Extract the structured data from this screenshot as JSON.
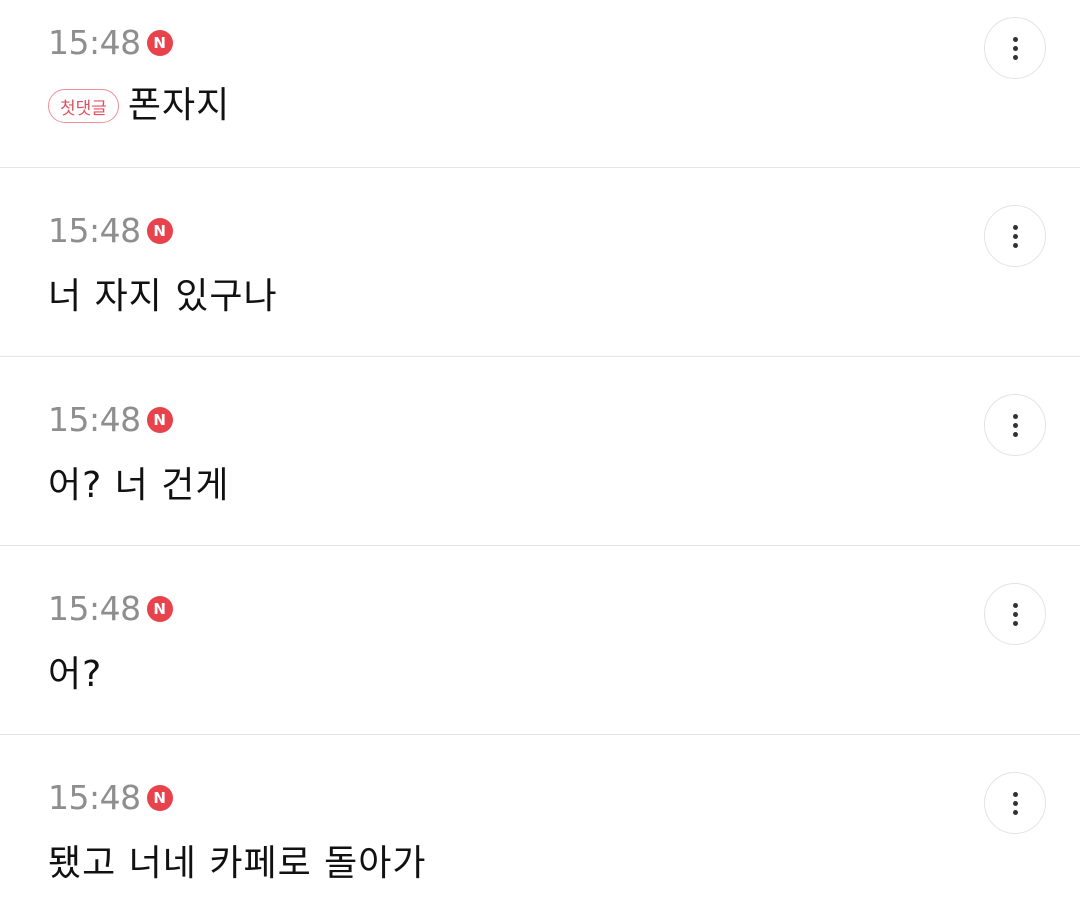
{
  "theme": {
    "new_badge_color": "#e8424c",
    "first_comment_badge_color": "#e0535e",
    "time_color": "#8e8e8e"
  },
  "comments": [
    {
      "time": "15:48",
      "new_badge": "N",
      "first_badge": "첫댓글",
      "text": "폰자지",
      "more_icon": "more-vertical-icon"
    },
    {
      "time": "15:48",
      "new_badge": "N",
      "text": "너 자지 있구나",
      "more_icon": "more-vertical-icon"
    },
    {
      "time": "15:48",
      "new_badge": "N",
      "text": "어? 너 건게",
      "more_icon": "more-vertical-icon"
    },
    {
      "time": "15:48",
      "new_badge": "N",
      "text": "어?",
      "more_icon": "more-vertical-icon"
    },
    {
      "time": "15:48",
      "new_badge": "N",
      "text": "됐고 너네 카페로 돌아가",
      "more_icon": "more-vertical-icon"
    }
  ]
}
